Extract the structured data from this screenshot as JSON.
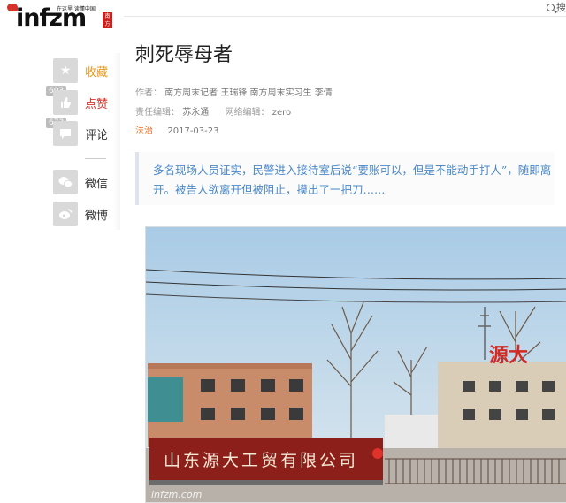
{
  "logo": {
    "text": "infzm",
    "slogan": "在这里  读懂中国",
    "seal": "南方"
  },
  "search": {
    "label": "搜"
  },
  "sidebar": {
    "items": [
      {
        "label": "收藏",
        "icon": "star-icon",
        "color": "#e89a1f"
      },
      {
        "label": "点赞",
        "icon": "thumbs-up-icon",
        "color": "#d6322b",
        "count": "603"
      },
      {
        "label": "评论",
        "icon": "comment-icon",
        "color": "#333333",
        "count": "673"
      },
      {
        "label": "微信",
        "icon": "wechat-icon",
        "color": "#333333"
      },
      {
        "label": "微博",
        "icon": "weibo-icon",
        "color": "#333333"
      }
    ]
  },
  "article": {
    "title": "刺死辱母者",
    "author_label": "作者：",
    "authors": "南方周末记者 王瑞锋 南方周末实习生 李倩",
    "editor_label": "责任编辑：",
    "editor": "苏永通",
    "web_editor_label": "网络编辑：",
    "web_editor": "zero",
    "channel": "法治",
    "date": "2017-03-23",
    "lead": "多名现场人员证实，民警进入接待室后说“要账可以，但是不能动手打人”，随即离开。被告人欲离开但被阻止，摸出了一把刀……"
  },
  "photo": {
    "sign_text": "山东源大工贸有限公司",
    "roof_sign": "源大",
    "watermark": "infzm.com"
  }
}
